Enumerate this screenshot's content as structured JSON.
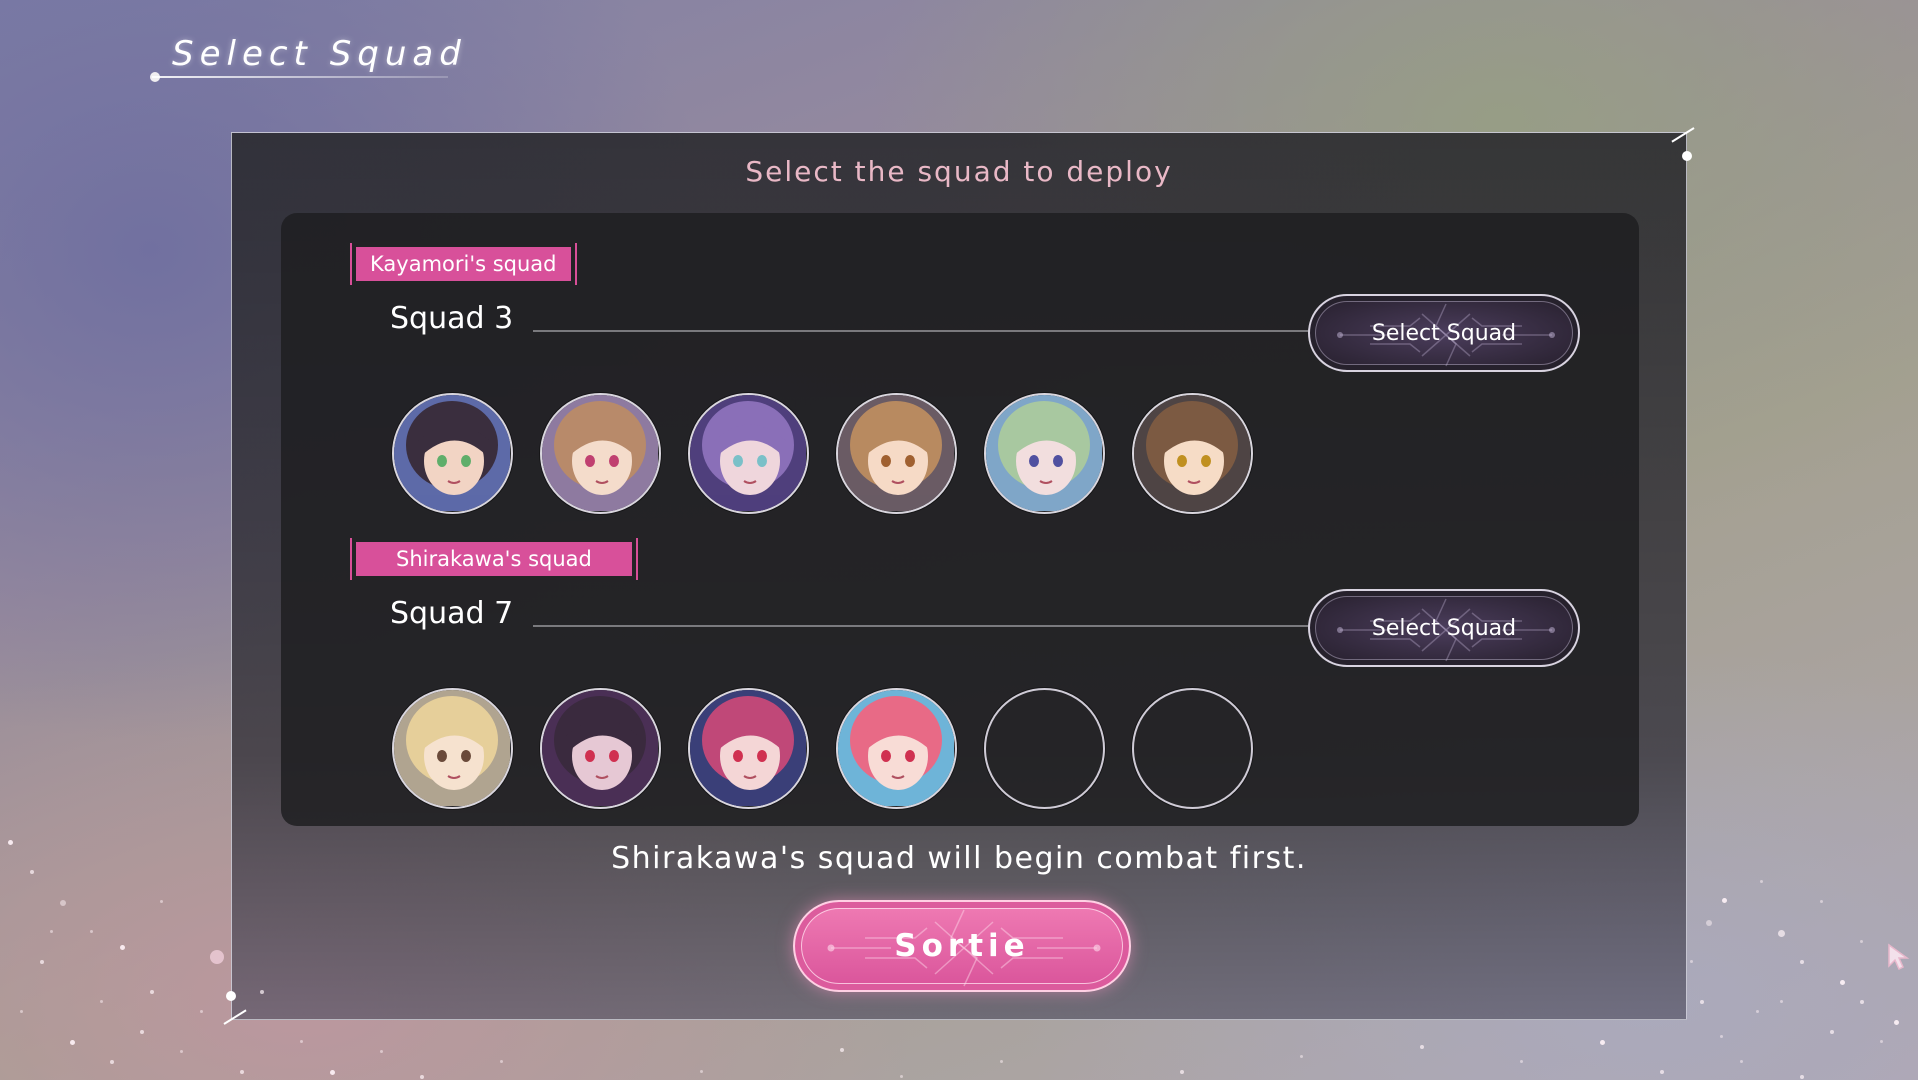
{
  "header": {
    "title": "Select Squad"
  },
  "panel": {
    "heading": "Select the squad to deploy",
    "squads": [
      {
        "tag": "Kayamori's squad",
        "name": "Squad 3",
        "select_label": "Select Squad",
        "members": [
          {
            "filled": true,
            "hair": "#3a2e3e",
            "skin": "#f2d4c4",
            "bg": "#5d6aa8",
            "eye": "#5fae6a"
          },
          {
            "filled": true,
            "hair": "#b88a6a",
            "skin": "#f4dccb",
            "bg": "#8e7aa0",
            "eye": "#c04070"
          },
          {
            "filled": true,
            "hair": "#8a6fb8",
            "skin": "#efd6dc",
            "bg": "#4f3f7c",
            "eye": "#7ac0c8"
          },
          {
            "filled": true,
            "hair": "#b88a60",
            "skin": "#f6dac6",
            "bg": "#6a5b64",
            "eye": "#a06030"
          },
          {
            "filled": true,
            "hair": "#a8c8a0",
            "skin": "#f2dede",
            "bg": "#7fa6c8",
            "eye": "#5050a0"
          },
          {
            "filled": true,
            "hair": "#7c5a42",
            "skin": "#f6dcc6",
            "bg": "#4e4444",
            "eye": "#c09020"
          }
        ]
      },
      {
        "tag": "Shirakawa's squad",
        "name": "Squad 7",
        "select_label": "Select Squad",
        "members": [
          {
            "filled": true,
            "hair": "#e6cf9a",
            "skin": "#f6e2cf",
            "bg": "#b0a490",
            "eye": "#6a4a3a"
          },
          {
            "filled": true,
            "hair": "#3a2a3e",
            "skin": "#e6c8d4",
            "bg": "#4a2f55",
            "eye": "#d03050"
          },
          {
            "filled": true,
            "hair": "#c04878",
            "skin": "#f4d6d6",
            "bg": "#3a3f78",
            "eye": "#d03050"
          },
          {
            "filled": true,
            "hair": "#e86a86",
            "skin": "#f8dcd6",
            "bg": "#6eb4d8",
            "eye": "#d03050"
          },
          {
            "filled": false
          },
          {
            "filled": false
          }
        ]
      }
    ],
    "notice": "Shirakawa's squad will begin combat first.",
    "sortie_label": "Sortie"
  },
  "colors": {
    "accent_pink": "#d8509a",
    "heading_pink": "#e9b8c6",
    "panel_bg": "#28282c"
  },
  "icons": {
    "cursor": "cursor-arrow-icon"
  }
}
